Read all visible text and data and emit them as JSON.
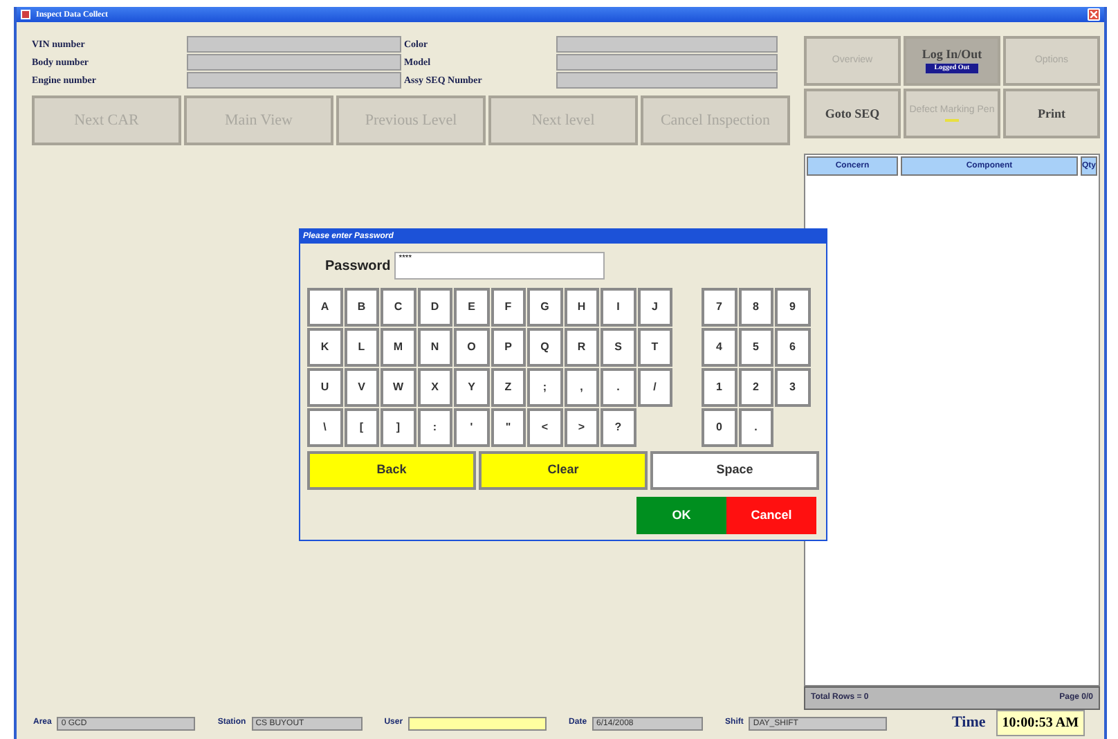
{
  "window": {
    "title": "Inspect Data Collect"
  },
  "fields": [
    {
      "label": "VIN number"
    },
    {
      "label": "Color"
    },
    {
      "label": "Body number"
    },
    {
      "label": "Model"
    },
    {
      "label": "Engine number"
    },
    {
      "label": "Assy SEQ Number"
    }
  ],
  "nav_buttons": [
    {
      "label": "Next CAR",
      "disabled": true
    },
    {
      "label": "Main View",
      "disabled": true
    },
    {
      "label": "Previous Level",
      "disabled": true
    },
    {
      "label": "Next level",
      "disabled": true
    },
    {
      "label": "Cancel Inspection",
      "disabled": true
    }
  ],
  "side_buttons": [
    {
      "label": "Overview",
      "disabled": true,
      "pressed": false
    },
    {
      "label": "Log In/Out",
      "disabled": false,
      "pressed": true,
      "badge": "Logged Out"
    },
    {
      "label": "Options",
      "disabled": true,
      "pressed": false
    },
    {
      "label": "Goto SEQ",
      "disabled": false,
      "pressed": false
    },
    {
      "label": "Defect Marking Pen",
      "disabled": true,
      "pressed": false,
      "indicator": true
    },
    {
      "label": "Print",
      "disabled": false,
      "pressed": false
    }
  ],
  "table": {
    "columns": [
      "Concern",
      "Component",
      "Qty"
    ],
    "total": "Total Rows = 0",
    "page": "Page 0/0"
  },
  "dialog": {
    "title": "Please enter Password",
    "password_label": "Password",
    "password_value": "****",
    "letter_rows": [
      [
        "A",
        "B",
        "C",
        "D",
        "E",
        "F",
        "G",
        "H",
        "I",
        "J"
      ],
      [
        "K",
        "L",
        "M",
        "N",
        "O",
        "P",
        "Q",
        "R",
        "S",
        "T"
      ],
      [
        "U",
        "V",
        "W",
        "X",
        "Y",
        "Z",
        ";",
        ",",
        ".",
        "/"
      ],
      [
        "\\",
        "[",
        "]",
        ":",
        "'",
        "\"",
        "<",
        ">",
        "?"
      ]
    ],
    "number_rows": [
      [
        "7",
        "8",
        "9"
      ],
      [
        "4",
        "5",
        "6"
      ],
      [
        "1",
        "2",
        "3"
      ],
      [
        "0",
        "."
      ]
    ],
    "wide_keys": [
      {
        "label": "Back",
        "color": "#ffff00"
      },
      {
        "label": "Clear",
        "color": "#ffff00"
      },
      {
        "label": "Space",
        "color": "#ffffff"
      }
    ],
    "actions": [
      {
        "label": "OK",
        "color": "#008f1f"
      },
      {
        "label": "Cancel",
        "color": "#ff1010"
      }
    ]
  },
  "status_bar": [
    {
      "label": "Area",
      "value": "0 GCD",
      "highlight": false
    },
    {
      "label": "Station",
      "value": "CS BUYOUT",
      "highlight": false
    },
    {
      "label": "User",
      "highlight": true
    },
    {
      "label": "Date",
      "value": "6/14/2008",
      "highlight": false
    },
    {
      "label": "Shift",
      "value": "DAY_SHIFT",
      "highlight": false
    }
  ],
  "time": {
    "label": "Time",
    "value": "10:00:53 AM"
  }
}
